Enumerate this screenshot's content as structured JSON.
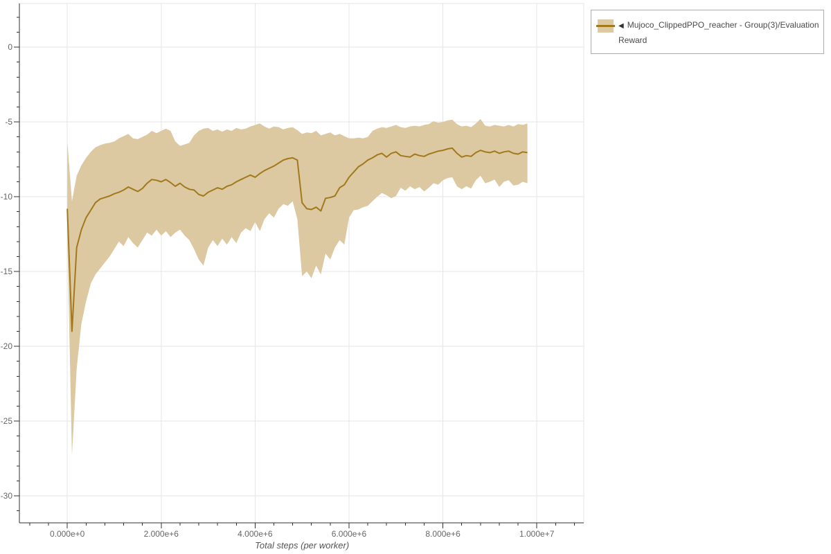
{
  "page": {
    "background": "#ffffff"
  },
  "colors": {
    "grid": "#e6e6e6",
    "axis": "#2f2f2f",
    "tick_label": "#666666",
    "axis_title": "#555555",
    "legend_border": "#adadad",
    "legend_text": "#4a4a4a",
    "series_line": "#a2781a",
    "series_band": "#dcc9a2"
  },
  "legend": {
    "toggle_icon": "◀",
    "label_line1": "Mujoco_ClippedPPO_reacher - Group(3)/Evaluation",
    "label_line2": "Reward",
    "series_color": "#a2781a",
    "band_color": "#dcc9a2"
  },
  "chart_data": {
    "type": "line",
    "title": "",
    "xlabel": "Total steps (per worker)",
    "ylabel": "",
    "grid": true,
    "legend_position": "top-right-outside",
    "xlim": [
      -1020000,
      11000000
    ],
    "ylim": [
      -31.8,
      2.92
    ],
    "x_ticks": {
      "values": [
        0,
        2000000,
        4000000,
        6000000,
        8000000,
        10000000
      ],
      "labels": [
        "0.000e+0",
        "2.000e+6",
        "4.000e+6",
        "6.000e+6",
        "8.000e+6",
        "1.000e+7"
      ],
      "minor_step": 400000
    },
    "y_ticks": {
      "values": [
        0,
        -5,
        -10,
        -15,
        -20,
        -25,
        -30
      ],
      "labels": [
        "0",
        "-5",
        "-10",
        "-15",
        "-20",
        "-25",
        "-30"
      ],
      "minor_step": 1
    },
    "series": [
      {
        "name": "Mujoco_ClippedPPO_reacher - Group(3)/Evaluation Reward",
        "color": "#a2781a",
        "band_color": "#dcc9a2",
        "x_start": 0,
        "x_step": 100000,
        "mean": [
          -10.8,
          -19.0,
          -13.4,
          -12.2,
          -11.4,
          -10.9,
          -10.4,
          -10.15,
          -10.05,
          -9.95,
          -9.8,
          -9.7,
          -9.55,
          -9.35,
          -9.5,
          -9.65,
          -9.45,
          -9.1,
          -8.85,
          -8.9,
          -9.0,
          -8.85,
          -9.05,
          -9.3,
          -9.1,
          -9.35,
          -9.5,
          -9.55,
          -9.85,
          -9.95,
          -9.7,
          -9.55,
          -9.4,
          -9.5,
          -9.3,
          -9.2,
          -9.0,
          -8.85,
          -8.7,
          -8.55,
          -8.7,
          -8.45,
          -8.25,
          -8.1,
          -7.95,
          -7.75,
          -7.55,
          -7.45,
          -7.4,
          -7.55,
          -10.4,
          -10.8,
          -10.85,
          -10.7,
          -10.95,
          -10.1,
          -10.05,
          -9.95,
          -9.4,
          -9.2,
          -8.7,
          -8.35,
          -8.0,
          -7.8,
          -7.55,
          -7.4,
          -7.2,
          -7.1,
          -7.35,
          -7.1,
          -7.0,
          -7.25,
          -7.3,
          -7.35,
          -7.15,
          -7.25,
          -7.3,
          -7.15,
          -7.05,
          -6.95,
          -6.9,
          -6.8,
          -6.75,
          -7.1,
          -7.35,
          -7.25,
          -7.3,
          -7.05,
          -6.9,
          -7.0,
          -7.05,
          -6.95,
          -7.1,
          -7.0,
          -6.95,
          -7.1,
          -7.15,
          -7.0,
          -7.05
        ],
        "band_upper": [
          -6.3,
          -10.3,
          -8.6,
          -7.9,
          -7.4,
          -7.0,
          -6.7,
          -6.55,
          -6.45,
          -6.4,
          -6.3,
          -6.1,
          -5.95,
          -5.8,
          -6.1,
          -6.15,
          -6.0,
          -5.85,
          -5.6,
          -5.75,
          -5.6,
          -5.45,
          -5.6,
          -6.3,
          -6.6,
          -6.5,
          -6.4,
          -5.9,
          -5.6,
          -5.45,
          -5.4,
          -5.6,
          -5.5,
          -5.65,
          -5.5,
          -5.6,
          -5.4,
          -5.5,
          -5.45,
          -5.3,
          -5.2,
          -5.1,
          -5.3,
          -5.45,
          -5.3,
          -5.35,
          -5.5,
          -5.4,
          -5.35,
          -5.55,
          -5.8,
          -5.7,
          -5.75,
          -5.6,
          -5.9,
          -5.8,
          -5.7,
          -5.9,
          -5.8,
          -5.95,
          -6.1,
          -6.1,
          -6.05,
          -6.1,
          -6.0,
          -5.6,
          -5.45,
          -5.35,
          -5.4,
          -5.3,
          -5.2,
          -5.35,
          -5.4,
          -5.3,
          -5.25,
          -5.3,
          -5.2,
          -5.15,
          -4.95,
          -5.05,
          -5.0,
          -4.9,
          -4.85,
          -5.15,
          -5.3,
          -5.25,
          -5.35,
          -5.1,
          -4.8,
          -5.25,
          -5.3,
          -5.2,
          -5.25,
          -5.3,
          -5.2,
          -5.3,
          -5.15,
          -5.2,
          -5.1
        ],
        "band_lower": [
          -12.6,
          -27.3,
          -21.5,
          -18.5,
          -17.0,
          -15.8,
          -15.2,
          -14.8,
          -14.4,
          -14.0,
          -13.5,
          -13.0,
          -13.3,
          -12.7,
          -13.1,
          -13.4,
          -12.9,
          -12.4,
          -12.6,
          -12.2,
          -12.6,
          -12.3,
          -12.7,
          -12.4,
          -12.2,
          -12.6,
          -12.9,
          -13.5,
          -14.2,
          -14.6,
          -13.4,
          -12.9,
          -13.3,
          -12.8,
          -13.2,
          -12.7,
          -13.1,
          -12.4,
          -12.1,
          -12.3,
          -11.7,
          -12.3,
          -11.5,
          -11.1,
          -11.4,
          -10.8,
          -10.5,
          -10.6,
          -10.3,
          -11.5,
          -15.3,
          -15.0,
          -15.45,
          -14.6,
          -15.2,
          -13.8,
          -14.2,
          -13.4,
          -12.9,
          -13.2,
          -11.4,
          -10.9,
          -10.85,
          -10.7,
          -10.6,
          -10.3,
          -10.0,
          -9.75,
          -9.9,
          -10.1,
          -9.95,
          -9.4,
          -9.6,
          -9.3,
          -9.5,
          -9.35,
          -9.65,
          -9.4,
          -9.1,
          -9.2,
          -8.9,
          -8.75,
          -8.7,
          -9.3,
          -9.5,
          -9.3,
          -9.45,
          -8.9,
          -8.6,
          -9.1,
          -9.0,
          -8.85,
          -9.35,
          -9.0,
          -8.9,
          -9.25,
          -9.2,
          -9.0,
          -9.1
        ]
      }
    ]
  }
}
